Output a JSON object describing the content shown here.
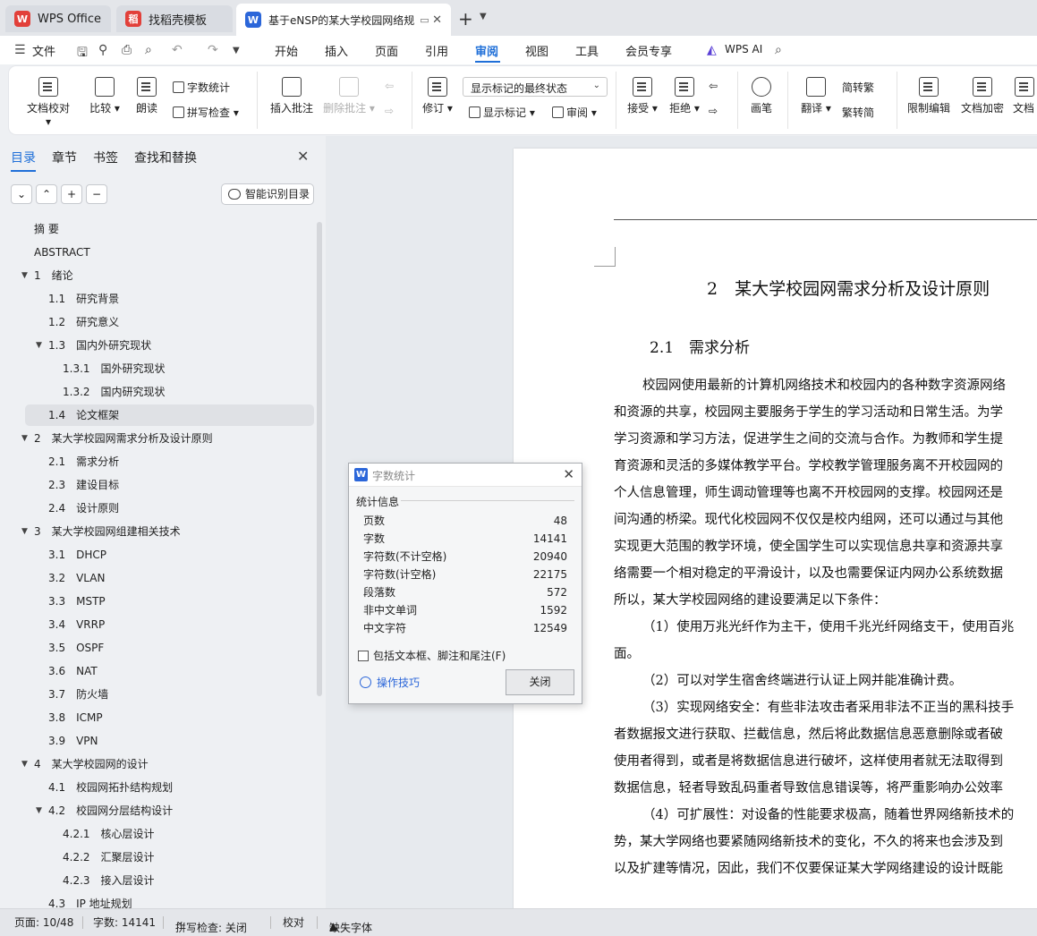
{
  "tabs": [
    {
      "label": "WPS Office",
      "logo": "W",
      "color": "#e2403a"
    },
    {
      "label": "找稻壳模板",
      "logo": "稻",
      "color": "#e2403a"
    },
    {
      "label": "基于eNSP的某大学校园网络规",
      "logo": "W",
      "color": "#2b66d9"
    }
  ],
  "menu": {
    "file": "文件",
    "items": [
      "开始",
      "插入",
      "页面",
      "引用",
      "审阅",
      "视图",
      "工具",
      "会员专享"
    ],
    "active": "审阅",
    "ai": "WPS AI"
  },
  "ribbon": {
    "doc_proof": "文档校对",
    "compare": "比较",
    "read_aloud": "朗读",
    "word_count": "字数统计",
    "spell_check": "拼写检查",
    "insert_comment": "插入批注",
    "delete_comment": "删除批注",
    "track": "修订",
    "display_state": "显示标记的最终状态",
    "show_markup": "显示标记",
    "review_pane": "审阅",
    "accept": "接受",
    "reject": "拒绝",
    "pen": "画笔",
    "translate": "翻译",
    "to_traditional": "简转繁",
    "to_simplified": "繁转简",
    "restrict_edit": "限制编辑",
    "encrypt": "文档加密",
    "doc_more": "文档"
  },
  "nav": {
    "tabs": [
      "目录",
      "章节",
      "书签",
      "查找和替换"
    ],
    "smart_toc": "智能识别目录",
    "toc": [
      {
        "num": "",
        "title": "摘  要",
        "level": 0,
        "tri": false
      },
      {
        "num": "",
        "title": "ABSTRACT",
        "level": 0,
        "tri": false
      },
      {
        "num": "1",
        "title": "绪论",
        "level": 0,
        "tri": true
      },
      {
        "num": "1.1",
        "title": "研究背景",
        "level": 1,
        "tri": false
      },
      {
        "num": "1.2",
        "title": "研究意义",
        "level": 1,
        "tri": false
      },
      {
        "num": "1.3",
        "title": "国内外研究现状",
        "level": 1,
        "tri": true
      },
      {
        "num": "1.3.1",
        "title": "国外研究现状",
        "level": 2,
        "tri": false
      },
      {
        "num": "1.3.2",
        "title": "国内研究现状",
        "level": 2,
        "tri": false
      },
      {
        "num": "1.4",
        "title": "论文框架",
        "level": 1,
        "tri": false,
        "selected": true
      },
      {
        "num": "2",
        "title": "某大学校园网需求分析及设计原则",
        "level": 0,
        "tri": true
      },
      {
        "num": "2.1",
        "title": "需求分析",
        "level": 1,
        "tri": false
      },
      {
        "num": "2.3",
        "title": "建设目标",
        "level": 1,
        "tri": false
      },
      {
        "num": "2.4",
        "title": "设计原则",
        "level": 1,
        "tri": false
      },
      {
        "num": "3",
        "title": "某大学校园网组建相关技术",
        "level": 0,
        "tri": true
      },
      {
        "num": "3.1",
        "title": "DHCP",
        "level": 1,
        "tri": false
      },
      {
        "num": "3.2",
        "title": "VLAN",
        "level": 1,
        "tri": false
      },
      {
        "num": "3.3",
        "title": "MSTP",
        "level": 1,
        "tri": false
      },
      {
        "num": "3.4",
        "title": "VRRP",
        "level": 1,
        "tri": false
      },
      {
        "num": "3.5",
        "title": "OSPF",
        "level": 1,
        "tri": false
      },
      {
        "num": "3.6",
        "title": "NAT",
        "level": 1,
        "tri": false
      },
      {
        "num": "3.7",
        "title": "防火墙",
        "level": 1,
        "tri": false
      },
      {
        "num": "3.8",
        "title": "ICMP",
        "level": 1,
        "tri": false
      },
      {
        "num": "3.9",
        "title": "VPN",
        "level": 1,
        "tri": false
      },
      {
        "num": "4",
        "title": "某大学校园网的设计",
        "level": 0,
        "tri": true
      },
      {
        "num": "4.1",
        "title": "校园网拓扑结构规划",
        "level": 1,
        "tri": false
      },
      {
        "num": "4.2",
        "title": "校园网分层结构设计",
        "level": 1,
        "tri": true
      },
      {
        "num": "4.2.1",
        "title": "核心层设计",
        "level": 2,
        "tri": false
      },
      {
        "num": "4.2.2",
        "title": "汇聚层设计",
        "level": 2,
        "tri": false
      },
      {
        "num": "4.2.3",
        "title": "接入层设计",
        "level": 2,
        "tri": false
      },
      {
        "num": "4.3",
        "title": "IP 地址规划",
        "level": 1,
        "tri": false
      }
    ]
  },
  "doc": {
    "h1": "2　某大学校园网需求分析及设计原则",
    "h2": "2.1　需求分析",
    "lines": [
      "校园网使用最新的计算机网络技术和校园内的各种数字资源网络",
      "和资源的共享，校园网主要服务于学生的学习活动和日常生活。为学",
      "学习资源和学习方法，促进学生之间的交流与合作。为教师和学生提",
      "育资源和灵活的多媒体教学平台。学校教学管理服务离不开校园网的",
      "个人信息管理，师生调动管理等也离不开校园网的支撑。校园网还是",
      "间沟通的桥梁。现代化校园网不仅仅是校内组网，还可以通过与其他",
      "实现更大范围的教学环境，使全国学生可以实现信息共享和资源共享",
      "络需要一个相对稳定的平滑设计，以及也需要保证内网办公系统数据",
      "所以，某大学校园网络的建设要满足以下条件：",
      "（1）使用万兆光纤作为主干，使用千兆光纤网络支干，使用百兆",
      "面。",
      "（2）可以对学生宿舍终端进行认证上网并能准确计费。",
      "（3）实现网络安全：有些非法攻击者采用非法不正当的黑科技手",
      "者数据报文进行获取、拦截信息，然后将此数据信息恶意删除或者破",
      "使用者得到，或者是将数据信息进行破坏，这样使用者就无法取得到",
      "数据信息，轻者导致乱码重者导致信息错误等，将严重影响办公效率",
      "（4）可扩展性：对设备的性能要求极高，随着世界网络新技术的",
      "势，某大学网络也要紧随网络新技术的变化，不久的将来也会涉及到",
      "以及扩建等情况，因此，我们不仅要保证某大学网络建设的设计既能"
    ],
    "indented": [
      0,
      9,
      11,
      12,
      16
    ]
  },
  "dialog": {
    "title": "字数统计",
    "group": "统计信息",
    "rows": [
      {
        "label": "页数",
        "value": "48"
      },
      {
        "label": "字数",
        "value": "14141"
      },
      {
        "label": "字符数(不计空格)",
        "value": "20940"
      },
      {
        "label": "字符数(计空格)",
        "value": "22175"
      },
      {
        "label": "段落数",
        "value": "572"
      },
      {
        "label": "非中文单词",
        "value": "1592"
      },
      {
        "label": "中文字符",
        "value": "12549"
      }
    ],
    "checkbox": "包括文本框、脚注和尾注(F)",
    "tips": "操作技巧",
    "close": "关闭"
  },
  "status": {
    "page": "页面: 10/48",
    "words": "字数: 14141",
    "spell": "拼写检查: 关闭",
    "proof": "校对",
    "missing_font": "缺失字体"
  }
}
